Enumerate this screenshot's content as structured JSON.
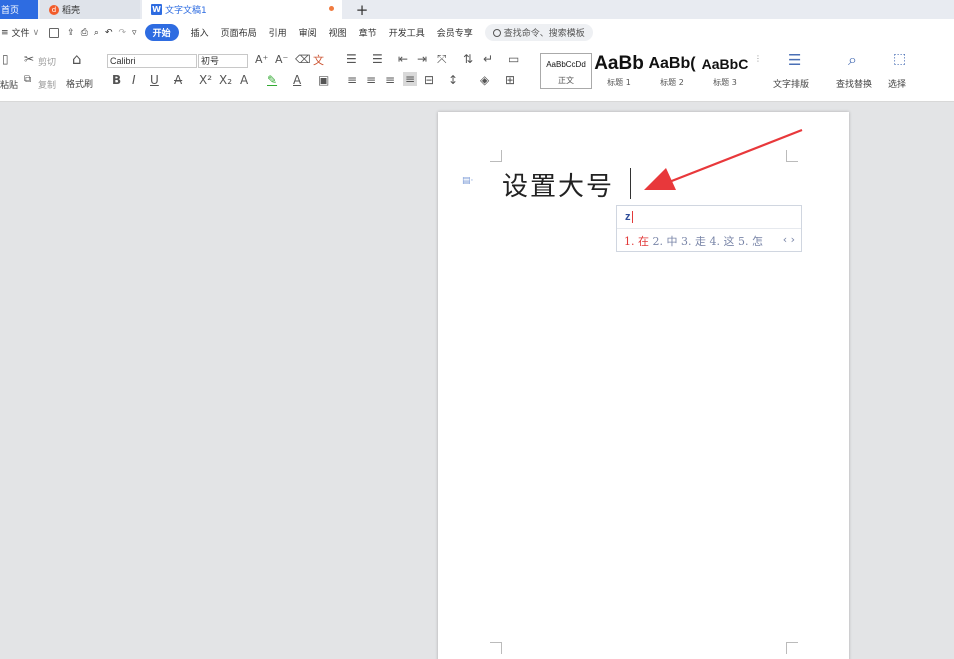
{
  "tabs": {
    "home": "首页",
    "daoke": "稻壳",
    "doc": "文字文稿1",
    "plus": "+"
  },
  "menubar": {
    "file": "文件",
    "items": [
      "开始",
      "插入",
      "页面布局",
      "引用",
      "审阅",
      "视图",
      "章节",
      "开发工具",
      "会员专享"
    ],
    "search_placeholder": "查找命令、搜索模板"
  },
  "ribbon": {
    "cut": "剪切",
    "copy": "复制",
    "paste": "粘贴",
    "format_painter": "格式刷",
    "font_name": "Calibri",
    "font_size": "初号",
    "styles": [
      {
        "preview": "AaBbCcDd",
        "label": "正文"
      },
      {
        "preview": "AaBb",
        "label": "标题 1"
      },
      {
        "preview": "AaBb(",
        "label": "标题 2"
      },
      {
        "preview": "AaBbC",
        "label": "标题 3"
      }
    ],
    "text_layout": "文字排版",
    "find_replace": "查找替换",
    "select": "选择"
  },
  "document": {
    "text": "设置大号"
  },
  "ime": {
    "input": "z",
    "candidates": "1. 在 2. 中 3. 走 4. 这 5. 怎",
    "candidate_first": "1. 在",
    "candidate_rest": " 2. 中 3. 走 4. 这 5. 怎",
    "nav": "‹ ›"
  },
  "colors": {
    "accent": "#2e6ce1",
    "arrow": "#e8383b"
  }
}
